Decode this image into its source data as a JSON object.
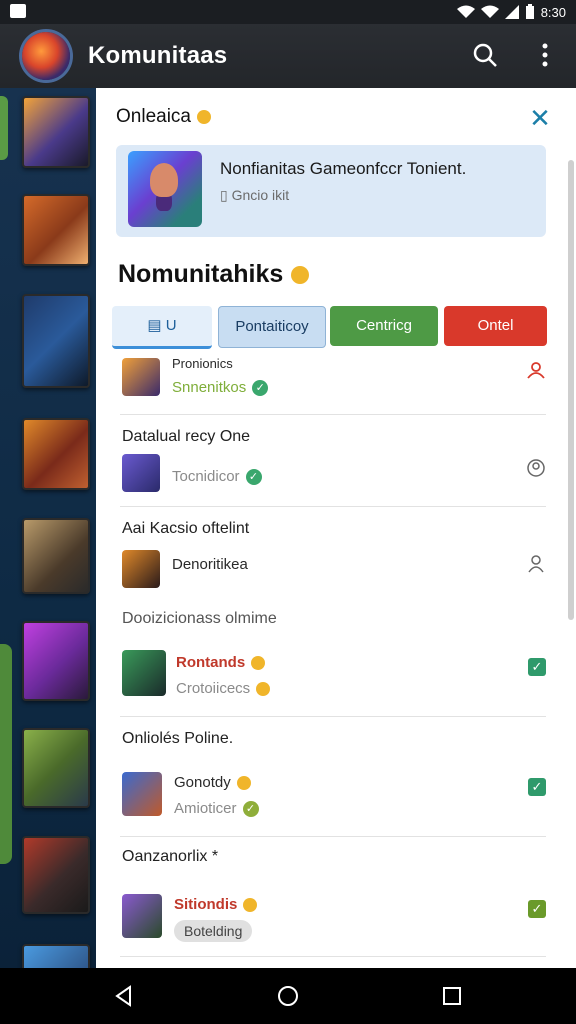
{
  "status": {
    "time": "8:30"
  },
  "appbar": {
    "title": "Komunitaas"
  },
  "sheet": {
    "header": "Onleaica",
    "banner": {
      "title": "Nonfianitas Gameonfccr Tonient.",
      "subtitle": "Gncio ikit"
    },
    "section_title": "Nomunitahiks",
    "tabs": [
      "U",
      "Pontaiticoy",
      "Centricg",
      "Ontel"
    ]
  },
  "list": {
    "row1": {
      "name": "Pronionics",
      "sub": "Snnenitkos"
    },
    "head2": "Datalual recy One",
    "row2": {
      "sub": "Tocnidicor"
    },
    "head3": "Aai Kacsio oftelint",
    "row3": {
      "name": "Denoritikea"
    },
    "head4": "Dooizicionass olmime",
    "row4": {
      "name": "Rontands",
      "sub": "Crotoiicecs"
    },
    "head5": "Onliolés Poline.",
    "row5": {
      "name": "Gonotdy",
      "sub": "Amioticer"
    },
    "head6": "Oanzanorlix *",
    "row6": {
      "name": "Sitiondis",
      "chip": "Botelding"
    }
  },
  "colors": {
    "accent": "#1c7fa8",
    "green": "#4e9a45",
    "red": "#d9392b",
    "blue_tab": "#c8ddf2"
  },
  "icons": [
    "photo-icon",
    "wifi-icon",
    "signal-icon",
    "battery-icon",
    "search-icon",
    "more-icon",
    "close-icon",
    "coin-icon",
    "check-icon",
    "person-icon",
    "back-icon",
    "home-icon",
    "recents-icon"
  ]
}
